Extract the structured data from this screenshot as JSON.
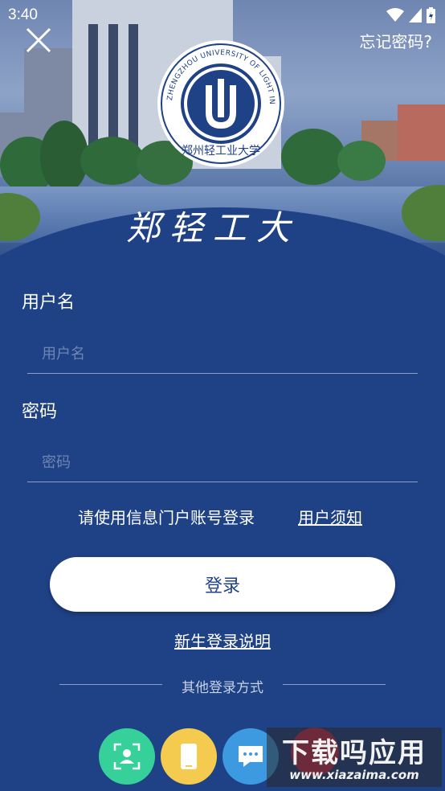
{
  "status_bar": {
    "time": "3:40"
  },
  "header": {
    "forgot_password": "忘记密码?"
  },
  "logo": {
    "ring_text": "ZHENGZHOU UNIVERSITY OF LIGHT INDUSTRY",
    "seal_text": "郑州轻工业大学"
  },
  "calligraphy_title": "郑轻工大",
  "form": {
    "username_label": "用户名",
    "username_placeholder": "用户名",
    "password_label": "密码",
    "password_placeholder": "密码"
  },
  "notice": {
    "text": "请使用信息门户账号登录",
    "terms_link": "用户须知"
  },
  "login_button": "登录",
  "freshman_link": "新生登录说明",
  "other_login": {
    "title": "其他登录方式",
    "methods": [
      {
        "icon": "face-scan-icon",
        "color": "#36d09a"
      },
      {
        "icon": "phone-icon",
        "color": "#f5cb4f"
      },
      {
        "icon": "chat-icon",
        "color": "#3e9ae0"
      }
    ]
  },
  "watermark": {
    "title": "下载吗应用",
    "url": "www.xiazaima.com"
  }
}
